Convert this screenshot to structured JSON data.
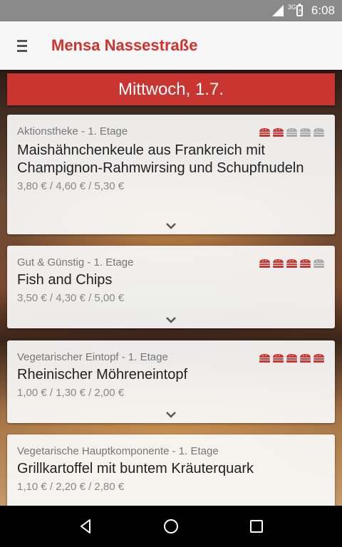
{
  "status_bar": {
    "network": "3G",
    "time": "6:08",
    "icons": [
      "wifi-icon",
      "signal-icon",
      "battery-charging-icon"
    ]
  },
  "app_bar": {
    "title": "Mensa Nassestraße",
    "menu_icon": "hamburger-menu-icon"
  },
  "day_header": "Mittwoch, 1.7.",
  "meals": [
    {
      "location": "Aktionstheke - 1. Etage",
      "dish": "Maishähnchenkeule aus Frankreich mit Champignon-Rahmwirsing und Schupfnudeln",
      "price": "3,80 € / 4,60 € / 5,30 €",
      "rating": 2,
      "rating_max": 5
    },
    {
      "location": "Gut & Günstig - 1. Etage",
      "dish": "Fish and Chips",
      "price": "3,50 € / 4,30 € / 5,00 €",
      "rating": 4,
      "rating_max": 5
    },
    {
      "location": "Vegetarischer Eintopf - 1. Etage",
      "dish": "Rheinischer Möhreneintopf",
      "price": "1,00 € / 1,30 € / 2,00 €",
      "rating": 5,
      "rating_max": 5
    },
    {
      "location": "Vegetarische Hauptkomponente - 1. Etage",
      "dish": "Grillkartoffel mit buntem Kräuterquark",
      "price": "1,10 € / 2,20 € / 2,80 €",
      "rating": 0,
      "rating_max": 5
    }
  ],
  "colors": {
    "accent": "#d0332d",
    "rating_active": "#c93530",
    "rating_inactive": "#a8a8a8"
  },
  "nav_bar": {
    "icons": [
      "back-icon",
      "home-icon",
      "recents-icon"
    ]
  }
}
